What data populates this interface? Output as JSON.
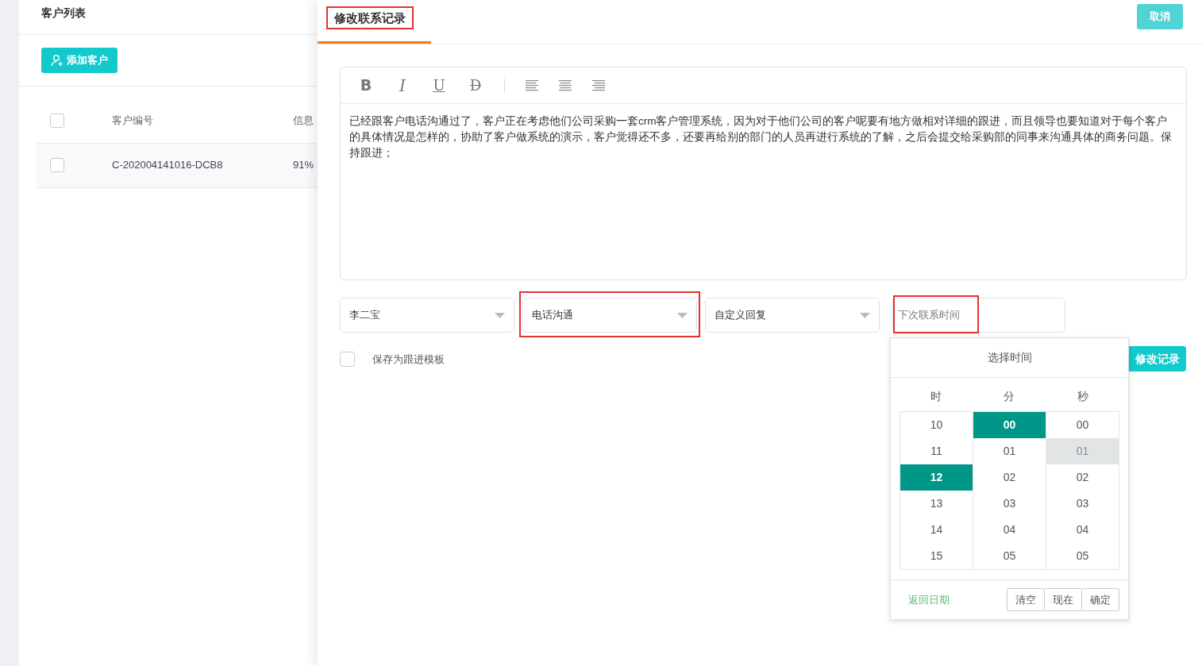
{
  "customer_list": {
    "title": "客户列表",
    "add_button": "添加客户",
    "columns": [
      "客户编号",
      "信息"
    ],
    "rows": [
      {
        "checked": false,
        "cells": [
          "C-202004141016-DCB8",
          "91%"
        ]
      }
    ],
    "header_checked": false
  },
  "drawer": {
    "tabs": [
      {
        "label": "修改联系记录",
        "selected": true,
        "highlighted": true
      }
    ],
    "cancel_button": "取消",
    "toolbar": [
      {
        "kind": "bold",
        "label": "B"
      },
      {
        "kind": "italic",
        "label": "I"
      },
      {
        "kind": "underline",
        "label": "U"
      },
      {
        "kind": "strike",
        "label": "D"
      },
      {
        "kind": "divider"
      },
      {
        "kind": "align-left"
      },
      {
        "kind": "align-center"
      },
      {
        "kind": "align-right"
      }
    ],
    "content": "已经跟客户电话沟通过了，客户正在考虑他们公司采购一套crm客户管理系统，因为对于他们公司的客户呢要有地方做相对详细的跟进，而且领导也要知道对于每个客户的具体情况是怎样的，协助了客户做系统的演示，客户觉得还不多，还要再给别的部门的人员再进行系统的了解，之后会提交给采购部的同事来沟通具体的商务问题。保持跟进；",
    "selects": [
      {
        "value": "李二宝",
        "highlighted": false
      },
      {
        "value": "电话沟通",
        "highlighted": true
      },
      {
        "value": "自定义回复",
        "highlighted": false
      }
    ],
    "next_contact": {
      "placeholder": "下次联系时间",
      "highlighted": true
    },
    "save_template": {
      "label": "保存为跟进模板",
      "checked": false
    },
    "submit_button": "修改记录",
    "time_picker": {
      "title": "选择时间",
      "columns": [
        {
          "header": "时",
          "items": [
            {
              "label": "10",
              "selected": false,
              "hovered": false
            },
            {
              "label": "11",
              "selected": false,
              "hovered": false
            },
            {
              "label": "12",
              "selected": true,
              "hovered": false
            },
            {
              "label": "13",
              "selected": false,
              "hovered": false
            },
            {
              "label": "14",
              "selected": false,
              "hovered": false
            },
            {
              "label": "15",
              "selected": false,
              "hovered": false
            }
          ]
        },
        {
          "header": "分",
          "items": [
            {
              "label": "00",
              "selected": true,
              "hovered": false
            },
            {
              "label": "01",
              "selected": false,
              "hovered": false
            },
            {
              "label": "02",
              "selected": false,
              "hovered": false
            },
            {
              "label": "03",
              "selected": false,
              "hovered": false
            },
            {
              "label": "04",
              "selected": false,
              "hovered": false
            },
            {
              "label": "05",
              "selected": false,
              "hovered": false
            }
          ]
        },
        {
          "header": "秒",
          "items": [
            {
              "label": "00",
              "selected": false,
              "hovered": false
            },
            {
              "label": "01",
              "selected": false,
              "hovered": true
            },
            {
              "label": "02",
              "selected": false,
              "hovered": false
            },
            {
              "label": "03",
              "selected": false,
              "hovered": false
            },
            {
              "label": "04",
              "selected": false,
              "hovered": false
            },
            {
              "label": "05",
              "selected": false,
              "hovered": false
            }
          ]
        }
      ],
      "back_link": "返回日期",
      "buttons": [
        "清空",
        "现在",
        "确定"
      ]
    }
  }
}
